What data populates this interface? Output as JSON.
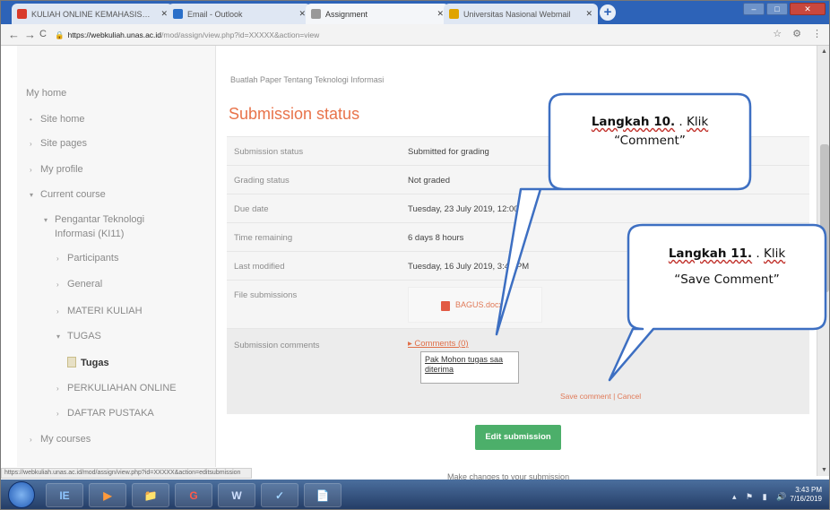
{
  "browser": {
    "tabs": [
      {
        "label": "KULIAH ONLINE KEMAHASISWAAN",
        "favicon_color": "#d93a2b",
        "active": false
      },
      {
        "label": "Email - Outlook",
        "favicon_color": "#2a6fc9",
        "active": false
      },
      {
        "label": "Assignment",
        "favicon_color": "#999999",
        "active": true
      },
      {
        "label": "Universitas Nasional Webmail",
        "favicon_color": "#e0a400",
        "active": false
      }
    ],
    "new_tab_symbol": "+",
    "window_controls": [
      "–",
      "□",
      "✕"
    ],
    "nav": {
      "back": "←",
      "forward": "→",
      "reload": "C"
    },
    "url": {
      "host": "https://webkuliah.unas.ac.id",
      "path": "/mod/assign/view.php?id=XXXXX&action=view"
    },
    "address_icons": [
      "☆",
      "⚙",
      "⋮"
    ]
  },
  "sidebar": {
    "items": [
      {
        "label": "My home",
        "caret": "",
        "indent": 0,
        "bold": false
      },
      {
        "label": "Site home",
        "caret": "•",
        "indent": 1,
        "bold": false
      },
      {
        "label": "Site pages",
        "caret": "›",
        "indent": 1,
        "bold": false
      },
      {
        "label": "My profile",
        "caret": "›",
        "indent": 1,
        "bold": false
      },
      {
        "label": "Current course",
        "caret": "▾",
        "indent": 1,
        "bold": false
      },
      {
        "label": "Pengantar Teknologi",
        "caret": "▾",
        "indent": 2,
        "bold": false
      },
      {
        "label": "Informasi (KI11)",
        "caret": "",
        "indent": 3,
        "bold": false
      },
      {
        "label": "Participants",
        "caret": "›",
        "indent": 3,
        "bold": false
      },
      {
        "label": "General",
        "caret": "›",
        "indent": 3,
        "bold": false
      },
      {
        "label": "MATERI KULIAH",
        "caret": "›",
        "indent": 3,
        "bold": false
      },
      {
        "label": "TUGAS",
        "caret": "▾",
        "indent": 3,
        "bold": false
      },
      {
        "label": "Tugas",
        "caret": "",
        "indent": 4,
        "bold": true
      },
      {
        "label": "PERKULIAHAN ONLINE",
        "caret": "›",
        "indent": 3,
        "bold": false
      },
      {
        "label": "DAFTAR PUSTAKA",
        "caret": "›",
        "indent": 3,
        "bold": false
      },
      {
        "label": "My courses",
        "caret": "›",
        "indent": 1,
        "bold": false
      }
    ]
  },
  "main": {
    "breadcrumb": "Buatlah Paper Tentang Teknologi Informasi",
    "section_title": "Submission status",
    "rows": [
      {
        "label": "Submission status",
        "value": "Submitted for grading",
        "green": false
      },
      {
        "label": "Grading status",
        "value": "Not graded",
        "green": false
      },
      {
        "label": "Due date",
        "value": "Tuesday, 23 July 2019, 12:00 AM",
        "green": false
      },
      {
        "label": "Time remaining",
        "value": "6 days 8 hours",
        "green": false
      },
      {
        "label": "Last modified",
        "value": "Tuesday, 16 July 2019, 3:42 PM",
        "green": false
      },
      {
        "label": "File submissions",
        "value": "",
        "green": false
      },
      {
        "label": "Submission comments",
        "value": "",
        "green": false
      }
    ],
    "file_name": "BAGUS.docx",
    "comments_link": "▸ Comments (0)",
    "comment_text": "Pak Mohon tugas saa diterima",
    "save_comment": "Save comment",
    "cancel": "Cancel",
    "edit_button": "Edit submission",
    "edit_hint": "Make changes to your submission"
  },
  "status_url": "https://webkuliah.unas.ac.id/mod/assign/view.php?id=XXXXX&action=editsubmission",
  "taskbar": {
    "apps": [
      "IE",
      "▶",
      "📁",
      "G",
      "W",
      "✓",
      "📄"
    ],
    "clock_time": "3:43 PM",
    "clock_date": "7/16/2019",
    "tray_icons": "▴ ⚑ ▮ 🔊"
  },
  "callouts": {
    "step10": {
      "bold": "Langkah 10.",
      "rest1": " . ",
      "word": "Klik",
      "line2": "“Comment”"
    },
    "step11": {
      "bold": "Langkah 11.",
      "rest1": " . ",
      "word": "Klik",
      "line2": "“Save Comment”"
    }
  },
  "colors": {
    "accent": "#e8734a",
    "callout_border": "#3d6fc2",
    "button": "#4caf6a"
  }
}
